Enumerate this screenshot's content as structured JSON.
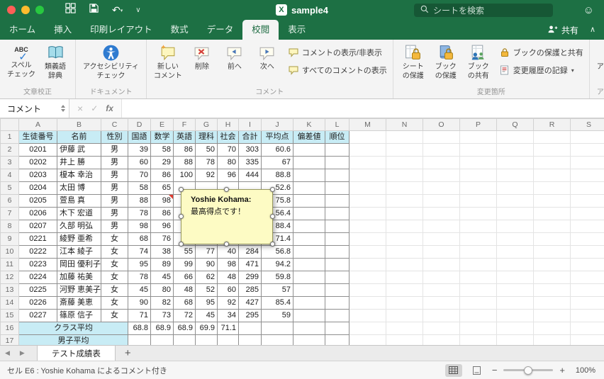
{
  "titlebar": {
    "title": "sample4",
    "app_badge": "X",
    "search_placeholder": "シートを検索"
  },
  "ribbon": {
    "active_tab_index": 5,
    "share_label": "共有",
    "tabs": [
      {
        "id": "home",
        "label": "ホーム"
      },
      {
        "id": "insert",
        "label": "挿入"
      },
      {
        "id": "page-layout",
        "label": "印刷レイアウト"
      },
      {
        "id": "formulas",
        "label": "数式"
      },
      {
        "id": "data",
        "label": "データ"
      },
      {
        "id": "review",
        "label": "校閲"
      },
      {
        "id": "view",
        "label": "表示"
      }
    ],
    "groups": [
      {
        "id": "proofing",
        "label": "文章校正",
        "buttons": [
          {
            "id": "spell-check",
            "icon": "abc-check",
            "label": "スペル\nチェック"
          },
          {
            "id": "thesaurus",
            "icon": "book",
            "label": "類義語\n辞典"
          }
        ]
      },
      {
        "id": "document",
        "label": "ドキュメント",
        "buttons": [
          {
            "id": "accessibility-check",
            "icon": "accessibility",
            "label": "アクセシビリティ\nチェック"
          }
        ]
      },
      {
        "id": "comments",
        "label": "コメント",
        "buttons": [
          {
            "id": "new-comment",
            "icon": "comment-new",
            "label": "新しい\nコメント"
          },
          {
            "id": "delete-comment",
            "icon": "comment-delete",
            "label": "削除"
          },
          {
            "id": "previous-comment",
            "icon": "comment-prev",
            "label": "前へ"
          },
          {
            "id": "next-comment",
            "icon": "comment-next",
            "label": "次へ"
          }
        ],
        "stack": [
          {
            "id": "show-hide-comment",
            "icon": "comment-outline",
            "label": "コメントの表示/非表示",
            "caret": false
          },
          {
            "id": "show-all-comments",
            "icon": "comment-outline",
            "label": "すべてのコメントの表示",
            "caret": false
          }
        ]
      },
      {
        "id": "changes",
        "label": "変更箇所",
        "buttons": [
          {
            "id": "protect-sheet",
            "icon": "lock-sheet",
            "label": "シート\nの保護"
          },
          {
            "id": "protect-workbook",
            "icon": "lock-book",
            "label": "ブック\nの保護"
          },
          {
            "id": "share-workbook",
            "icon": "share-book",
            "label": "ブック\nの共有"
          }
        ],
        "stack": [
          {
            "id": "protect-and-share-workbook",
            "icon": "lock-small",
            "label": "ブックの保護と共有",
            "caret": false
          },
          {
            "id": "track-changes",
            "icon": "track-small",
            "label": "変更履歴の記録",
            "caret": true
          }
        ]
      },
      {
        "id": "access",
        "label": "アクセス…",
        "buttons": [
          {
            "id": "restrict-access",
            "icon": "restrict",
            "label": "アクセスの\n制限"
          }
        ]
      }
    ]
  },
  "formula_bar": {
    "name_box": "コメント",
    "fx_label": "fx"
  },
  "grid": {
    "column_letters": [
      "A",
      "B",
      "C",
      "D",
      "E",
      "F",
      "G",
      "H",
      "I",
      "J",
      "K",
      "L",
      "M",
      "N",
      "O",
      "P",
      "Q",
      "R",
      "S"
    ],
    "rows": [
      {
        "type": "header",
        "cells": [
          "生徒番号",
          "名前",
          "性別",
          "国語",
          "数学",
          "英語",
          "理科",
          "社会",
          "合計",
          "平均点",
          "偏差値",
          "順位"
        ]
      },
      {
        "type": "data",
        "cells": [
          "0201",
          "伊藤 武",
          "男",
          "39",
          "58",
          "86",
          "50",
          "70",
          "303",
          "60.6",
          "",
          ""
        ]
      },
      {
        "type": "data",
        "cells": [
          "0202",
          "井上 勝",
          "男",
          "60",
          "29",
          "88",
          "78",
          "80",
          "335",
          "67",
          "",
          ""
        ]
      },
      {
        "type": "data",
        "cells": [
          "0203",
          "榎本 幸治",
          "男",
          "70",
          "86",
          "100",
          "92",
          "96",
          "444",
          "88.8",
          "",
          ""
        ]
      },
      {
        "type": "data",
        "cells": [
          "0204",
          "太田 博",
          "男",
          "58",
          "65",
          "",
          "",
          "",
          "",
          "52.6",
          "",
          ""
        ]
      },
      {
        "type": "data",
        "cells": [
          "0205",
          "萱島 真",
          "男",
          "88",
          "98",
          "",
          "",
          "",
          "",
          "75.8",
          "",
          ""
        ]
      },
      {
        "type": "data",
        "cells": [
          "0206",
          "木下 宏道",
          "男",
          "78",
          "86",
          "",
          "",
          "",
          "",
          "56.4",
          "",
          ""
        ]
      },
      {
        "type": "data",
        "cells": [
          "0207",
          "久部 明弘",
          "男",
          "98",
          "96",
          "",
          "",
          "",
          "",
          "88.4",
          "",
          ""
        ]
      },
      {
        "type": "data",
        "cells": [
          "0221",
          "綾野 亜希",
          "女",
          "68",
          "76",
          "",
          "",
          "",
          "",
          "71.4",
          "",
          ""
        ]
      },
      {
        "type": "data",
        "cells": [
          "0222",
          "江本 綾子",
          "女",
          "74",
          "38",
          "55",
          "77",
          "40",
          "284",
          "56.8",
          "",
          ""
        ]
      },
      {
        "type": "data",
        "cells": [
          "0223",
          "岡田 優利子",
          "女",
          "95",
          "89",
          "99",
          "90",
          "98",
          "471",
          "94.2",
          "",
          ""
        ]
      },
      {
        "type": "data",
        "cells": [
          "0224",
          "加藤 祐美",
          "女",
          "78",
          "45",
          "66",
          "62",
          "48",
          "299",
          "59.8",
          "",
          ""
        ]
      },
      {
        "type": "data",
        "cells": [
          "0225",
          "河野 恵美子",
          "女",
          "45",
          "80",
          "48",
          "52",
          "60",
          "285",
          "57",
          "",
          ""
        ]
      },
      {
        "type": "data",
        "cells": [
          "0226",
          "斎藤 美恵",
          "女",
          "90",
          "82",
          "68",
          "95",
          "92",
          "427",
          "85.4",
          "",
          ""
        ]
      },
      {
        "type": "data",
        "cells": [
          "0227",
          "篠原 信子",
          "女",
          "71",
          "73",
          "72",
          "45",
          "34",
          "295",
          "59",
          "",
          ""
        ]
      },
      {
        "type": "summary",
        "label": "クラス平均",
        "values": [
          "68.8",
          "68.9",
          "68.9",
          "69.9",
          "71.1",
          "",
          "",
          "",
          ""
        ]
      },
      {
        "type": "summary",
        "label": "男子平均",
        "values": [
          "",
          "",
          "",
          "",
          "",
          "",
          "",
          "",
          ""
        ]
      }
    ]
  },
  "comment": {
    "author": "Yoshie Kohama:",
    "text": "最高得点です！"
  },
  "sheet_tabs": {
    "active": "テスト成績表"
  },
  "status_bar": {
    "message": "セル E6 : Yoshie Kohama によるコメント付き",
    "zoom": "100%"
  }
}
